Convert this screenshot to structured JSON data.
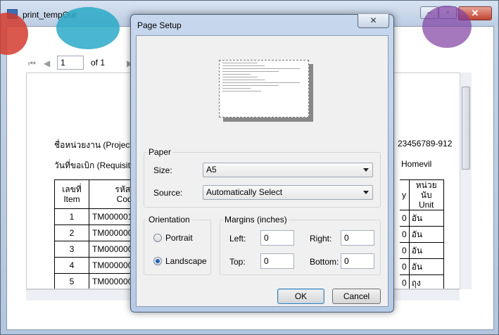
{
  "window": {
    "title": "print_tempOut"
  },
  "viewer": {
    "page_input": "1",
    "of_pages": "of 1"
  },
  "report": {
    "project_label": "ชื่อหน่วยงาน (Project)",
    "requisition_label": "วันที่ขอเบิก (Requisitio",
    "right_code": "23456789-912",
    "right_name": "Homevil",
    "col_no_th": "เลขที่",
    "col_no_en": "Item",
    "col_code_th": "รหัสสินค",
    "col_code_en": "Code N",
    "col_y": "y",
    "col_unit_th": "หน่วยนับ",
    "col_unit_en": "Unit",
    "rows": [
      {
        "no": "1",
        "code": "TM0000015",
        "q": "0",
        "unit": "อัน"
      },
      {
        "no": "2",
        "code": "TM0000000",
        "q": "0",
        "unit": "อัน"
      },
      {
        "no": "3",
        "code": "TM0000001",
        "q": "0",
        "unit": "อัน"
      },
      {
        "no": "4",
        "code": "TM0000002",
        "q": "0",
        "unit": "อัน"
      },
      {
        "no": "5",
        "code": "TM0000003",
        "q": "0",
        "unit": "ถุง"
      }
    ]
  },
  "dialog": {
    "title": "Page Setup",
    "close_glyph": "✕",
    "paper_legend": "Paper",
    "size_label": "Size:",
    "size_value": "A5",
    "source_label": "Source:",
    "source_value": "Automatically Select",
    "orientation_legend": "Orientation",
    "portrait_label": "Portrait",
    "landscape_label": "Landscape",
    "orientation_selected": "Landscape",
    "margins_legend": "Margins (inches)",
    "left_label": "Left:",
    "left_value": "0",
    "right_label": "Right:",
    "right_value": "0",
    "top_label": "Top:",
    "top_value": "0",
    "bottom_label": "Bottom:",
    "bottom_value": "0",
    "ok_label": "OK",
    "cancel_label": "Cancel"
  }
}
